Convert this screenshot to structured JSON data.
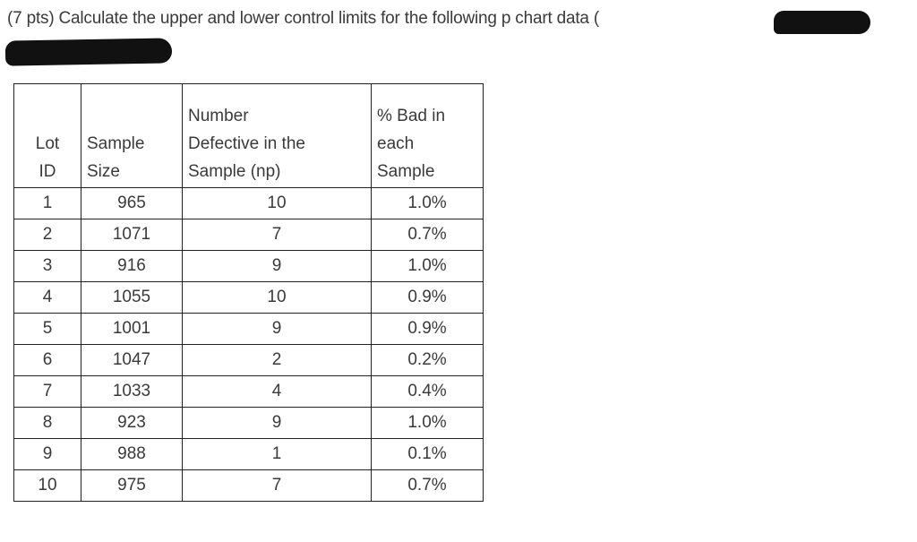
{
  "question": {
    "text": "(7 pts) Calculate the upper and lower control limits for the following p chart data ("
  },
  "table": {
    "headers": {
      "lot_id": [
        "Lot",
        "ID"
      ],
      "sample_size": [
        "Sample",
        "Size"
      ],
      "defective": [
        "Number",
        "Defective in the",
        "Sample (np)"
      ],
      "pct_bad": [
        "% Bad in",
        "each",
        "Sample"
      ]
    },
    "rows": [
      {
        "lot": "1",
        "size": "965",
        "np": "10",
        "pct": "1.0%"
      },
      {
        "lot": "2",
        "size": "1071",
        "np": "7",
        "pct": "0.7%"
      },
      {
        "lot": "3",
        "size": "916",
        "np": "9",
        "pct": "1.0%"
      },
      {
        "lot": "4",
        "size": "1055",
        "np": "10",
        "pct": "0.9%"
      },
      {
        "lot": "5",
        "size": "1001",
        "np": "9",
        "pct": "0.9%"
      },
      {
        "lot": "6",
        "size": "1047",
        "np": "2",
        "pct": "0.2%"
      },
      {
        "lot": "7",
        "size": "1033",
        "np": "4",
        "pct": "0.4%"
      },
      {
        "lot": "8",
        "size": "923",
        "np": "9",
        "pct": "1.0%"
      },
      {
        "lot": "9",
        "size": "988",
        "np": "1",
        "pct": "0.1%"
      },
      {
        "lot": "10",
        "size": "975",
        "np": "7",
        "pct": "0.7%"
      }
    ]
  }
}
